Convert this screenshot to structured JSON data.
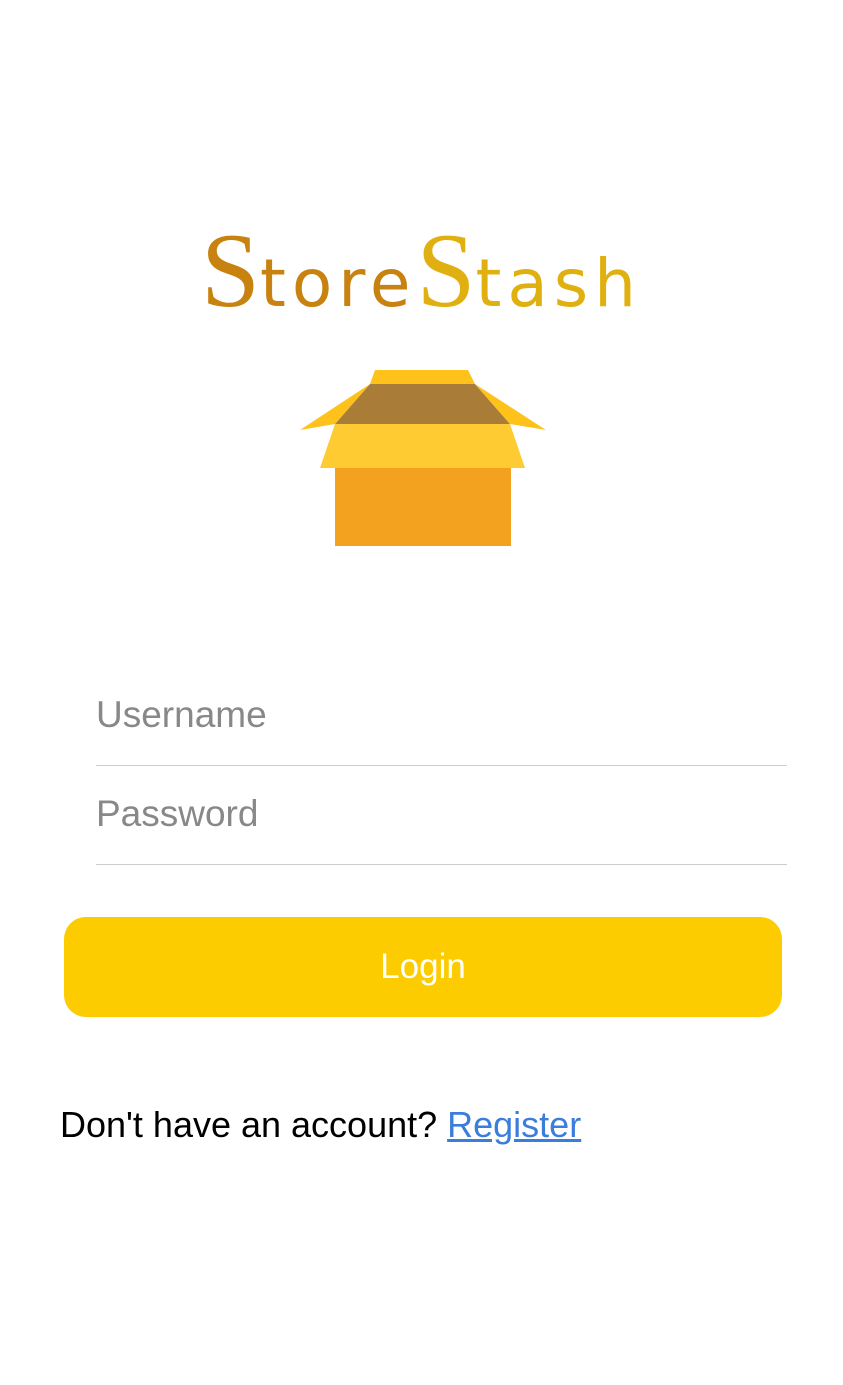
{
  "brand": {
    "word1_cap": "S",
    "word1_rest": "tore",
    "word2_cap": "S",
    "word2_rest": "tash",
    "icon": "open-box-icon",
    "colors": {
      "word1": "#c8820f",
      "word2": "#e0b010"
    }
  },
  "form": {
    "username_placeholder": "Username",
    "username_value": "",
    "password_placeholder": "Password",
    "password_value": "",
    "login_label": "Login"
  },
  "footer": {
    "prompt": "Don't have an account? ",
    "register_label": "Register"
  },
  "colors": {
    "accent": "#fccc00",
    "link": "#3b7ddd",
    "box_body": "#f3a220",
    "box_flap": "#ffcb32",
    "box_inside": "#a97c38"
  }
}
